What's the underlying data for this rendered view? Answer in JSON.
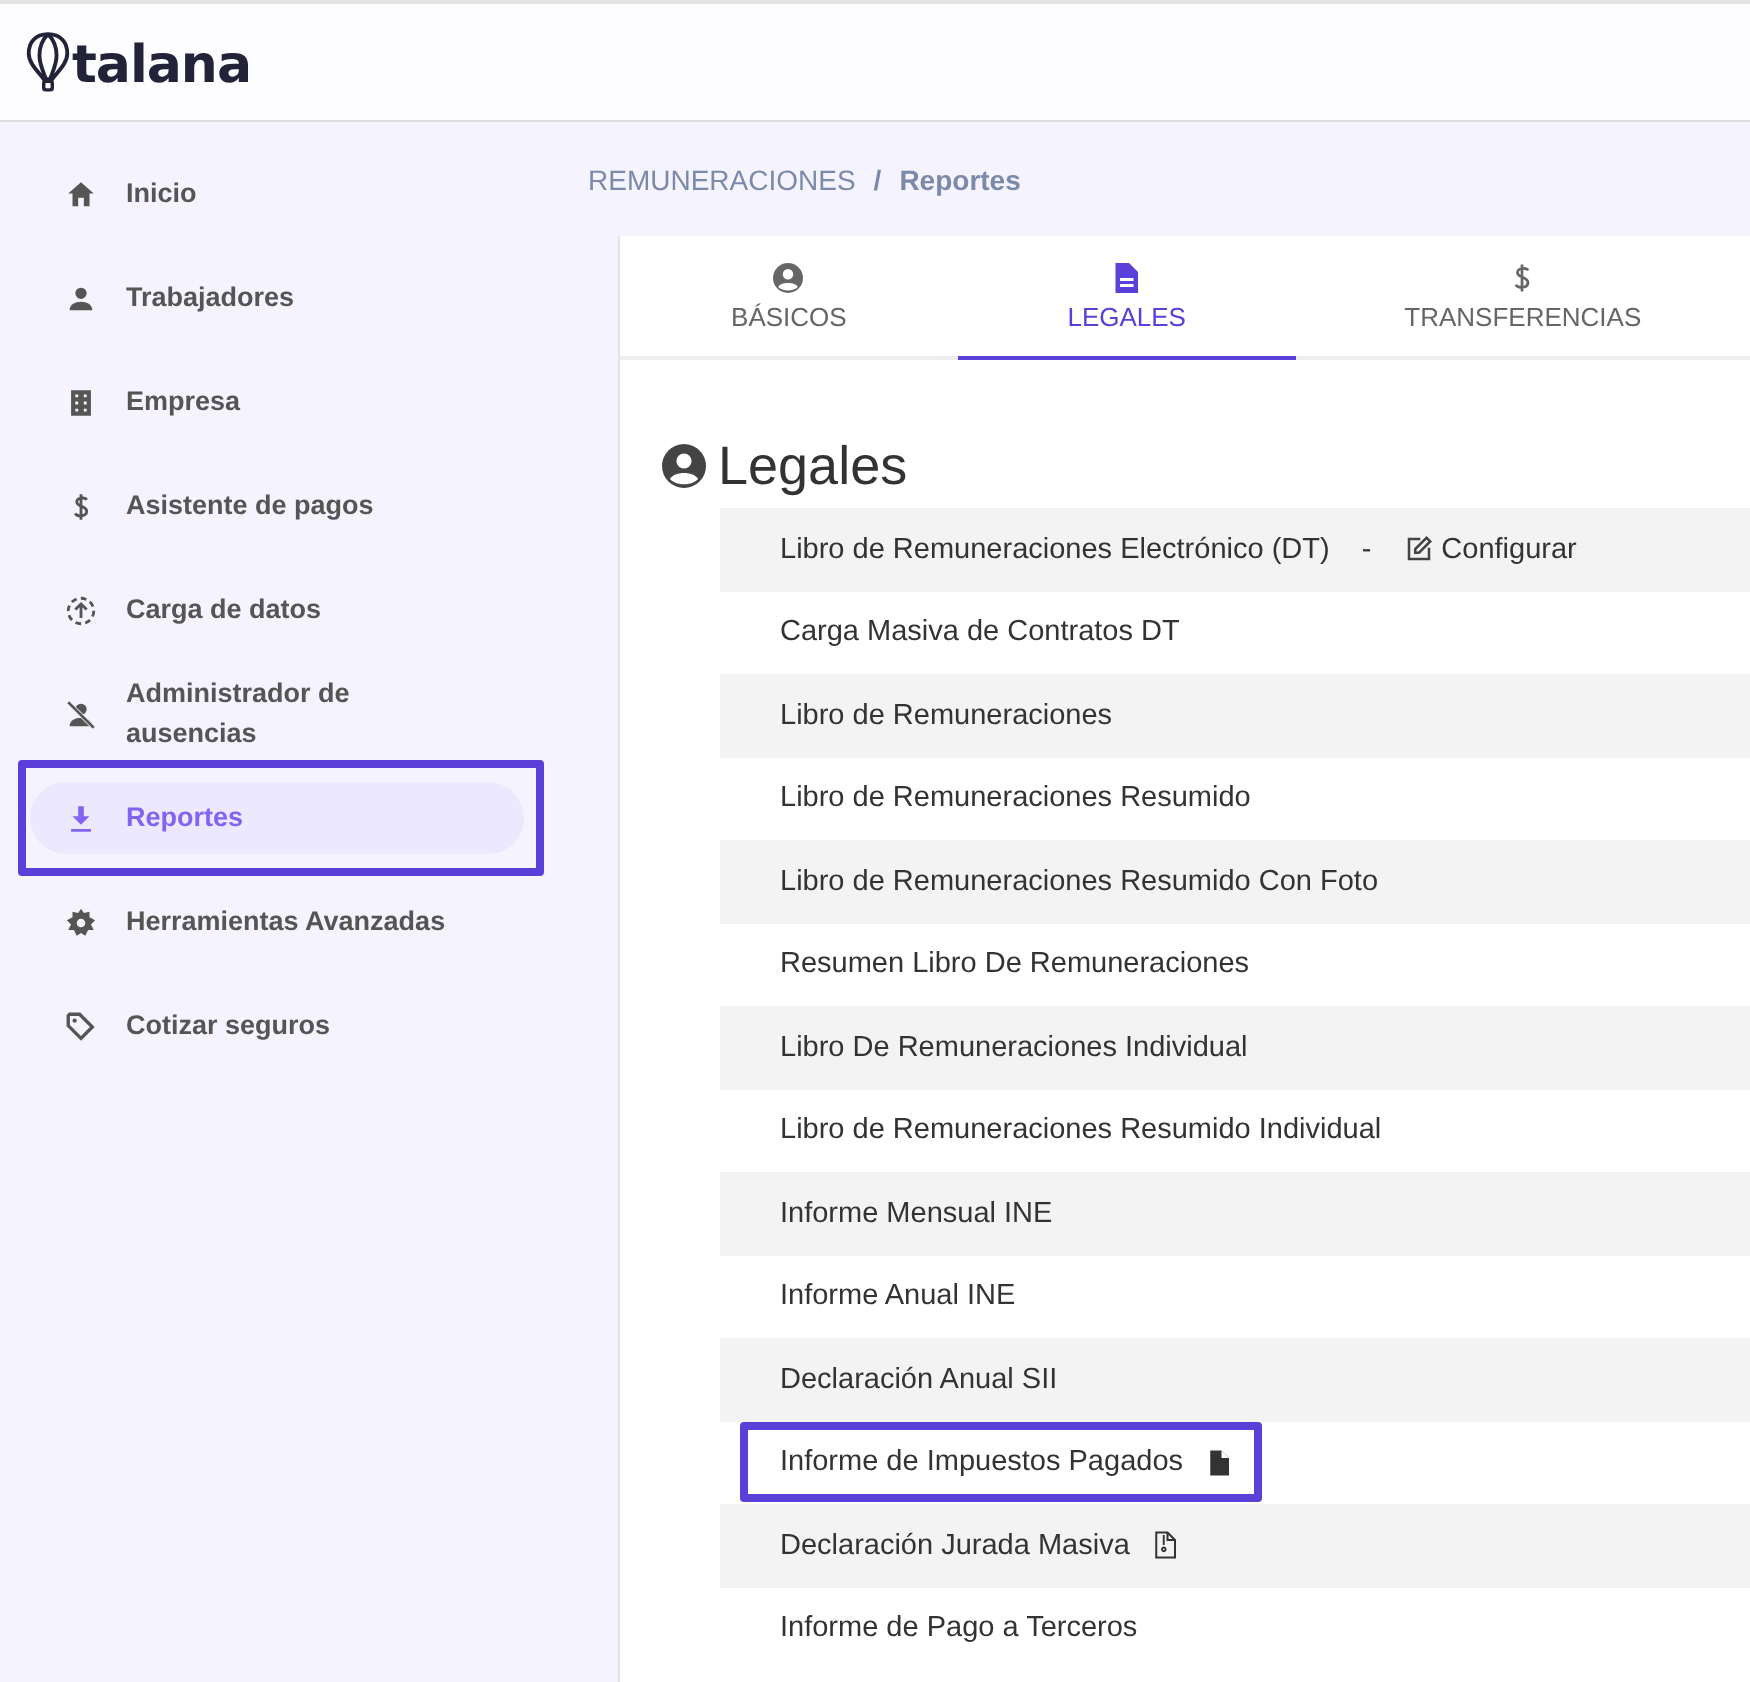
{
  "logo": {
    "text": "talana"
  },
  "sidebar": {
    "items": [
      {
        "label": "Inicio",
        "selected": false,
        "highlighted": false
      },
      {
        "label": "Trabajadores",
        "selected": false,
        "highlighted": false
      },
      {
        "label": "Empresa",
        "selected": false,
        "highlighted": false
      },
      {
        "label": "Asistente de pagos",
        "selected": false,
        "highlighted": false
      },
      {
        "label": "Carga de datos",
        "selected": false,
        "highlighted": false
      },
      {
        "label": "Administrador de ausencias",
        "selected": false,
        "highlighted": false
      },
      {
        "label": "Reportes",
        "selected": true,
        "highlighted": true
      },
      {
        "label": "Herramientas Avanzadas",
        "selected": false,
        "highlighted": false
      },
      {
        "label": "Cotizar seguros",
        "selected": false,
        "highlighted": false
      }
    ]
  },
  "breadcrumb": {
    "parent": "REMUNERACIONES",
    "separator": "/",
    "current": "Reportes"
  },
  "tabs": [
    {
      "label": "BÁSICOS",
      "selected": false
    },
    {
      "label": "LEGALES",
      "selected": true
    },
    {
      "label": "TRANSFERENCIAS",
      "selected": false
    }
  ],
  "section": {
    "title": "Legales"
  },
  "reports": [
    {
      "kind": "configurable",
      "label": "Libro de Remuneraciones Electrónico (DT)",
      "separator": "-",
      "link": "Configurar",
      "highlighted": false
    },
    {
      "kind": "plain",
      "label": "Carga Masiva de Contratos DT",
      "highlighted": false
    },
    {
      "kind": "plain",
      "label": "Libro de Remuneraciones",
      "highlighted": false
    },
    {
      "kind": "plain",
      "label": "Libro de Remuneraciones Resumido",
      "highlighted": false
    },
    {
      "kind": "plain",
      "label": "Libro de Remuneraciones Resumido Con Foto",
      "highlighted": false
    },
    {
      "kind": "plain",
      "label": "Resumen Libro De Remuneraciones",
      "highlighted": false
    },
    {
      "kind": "plain",
      "label": "Libro De Remuneraciones Individual",
      "highlighted": false
    },
    {
      "kind": "plain",
      "label": "Libro de Remuneraciones Resumido Individual",
      "highlighted": false
    },
    {
      "kind": "plain",
      "label": "Informe Mensual INE",
      "highlighted": false
    },
    {
      "kind": "plain",
      "label": "Informe Anual INE",
      "highlighted": false
    },
    {
      "kind": "plain",
      "label": "Declaración Anual SII",
      "highlighted": false
    },
    {
      "kind": "file",
      "label": "Informe de Impuestos Pagados",
      "highlighted": true
    },
    {
      "kind": "archive",
      "label": "Declaración Jurada Masiva",
      "highlighted": false
    },
    {
      "kind": "plain",
      "label": "Informe de Pago a Terceros",
      "highlighted": false
    }
  ]
}
